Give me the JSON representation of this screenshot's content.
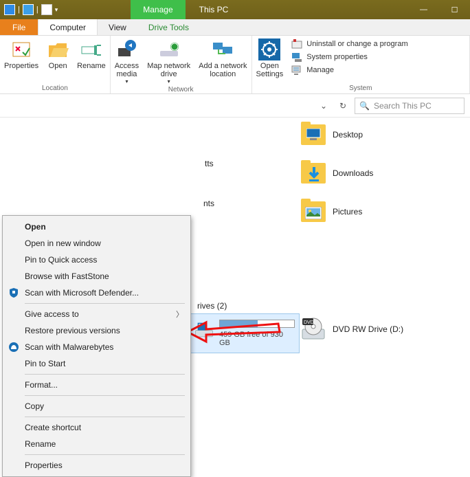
{
  "titlebar": {
    "manage": "Manage",
    "title": "This PC",
    "minimize": "—",
    "maximize": "☐"
  },
  "tabs": {
    "file": "File",
    "computer": "Computer",
    "view": "View",
    "drive_tools": "Drive Tools"
  },
  "ribbon": {
    "location": {
      "properties": "Properties",
      "open": "Open",
      "rename": "Rename",
      "label": "Location"
    },
    "network": {
      "access_media": "Access\nmedia",
      "map_drive": "Map network\ndrive",
      "add_location": "Add a network\nlocation",
      "label": "Network"
    },
    "system": {
      "open_settings": "Open\nSettings",
      "uninstall": "Uninstall or change a program",
      "sys_props": "System properties",
      "manage": "Manage",
      "label": "System"
    }
  },
  "addr": {
    "dropdown": "⌄",
    "refresh": "↻",
    "search_placeholder": "Search This PC",
    "search_icon": "🔍"
  },
  "folders": {
    "desktop": "Desktop",
    "downloads": "Downloads",
    "pictures": "Pictures"
  },
  "peek": {
    "tts": "tts",
    "nts": "nts"
  },
  "drives": {
    "header": "rives (2)",
    "c_free": "459 GB free of 930 GB",
    "d_label": "DVD RW Drive (D:)"
  },
  "context_menu": {
    "open": "Open",
    "open_new": "Open in new window",
    "pin_quick": "Pin to Quick access",
    "browse_fs": "Browse with FastStone",
    "defender": "Scan with Microsoft Defender...",
    "give_access": "Give access to",
    "restore": "Restore previous versions",
    "malwarebytes": "Scan with Malwarebytes",
    "pin_start": "Pin to Start",
    "format": "Format...",
    "copy": "Copy",
    "shortcut": "Create shortcut",
    "rename": "Rename",
    "properties": "Properties"
  }
}
